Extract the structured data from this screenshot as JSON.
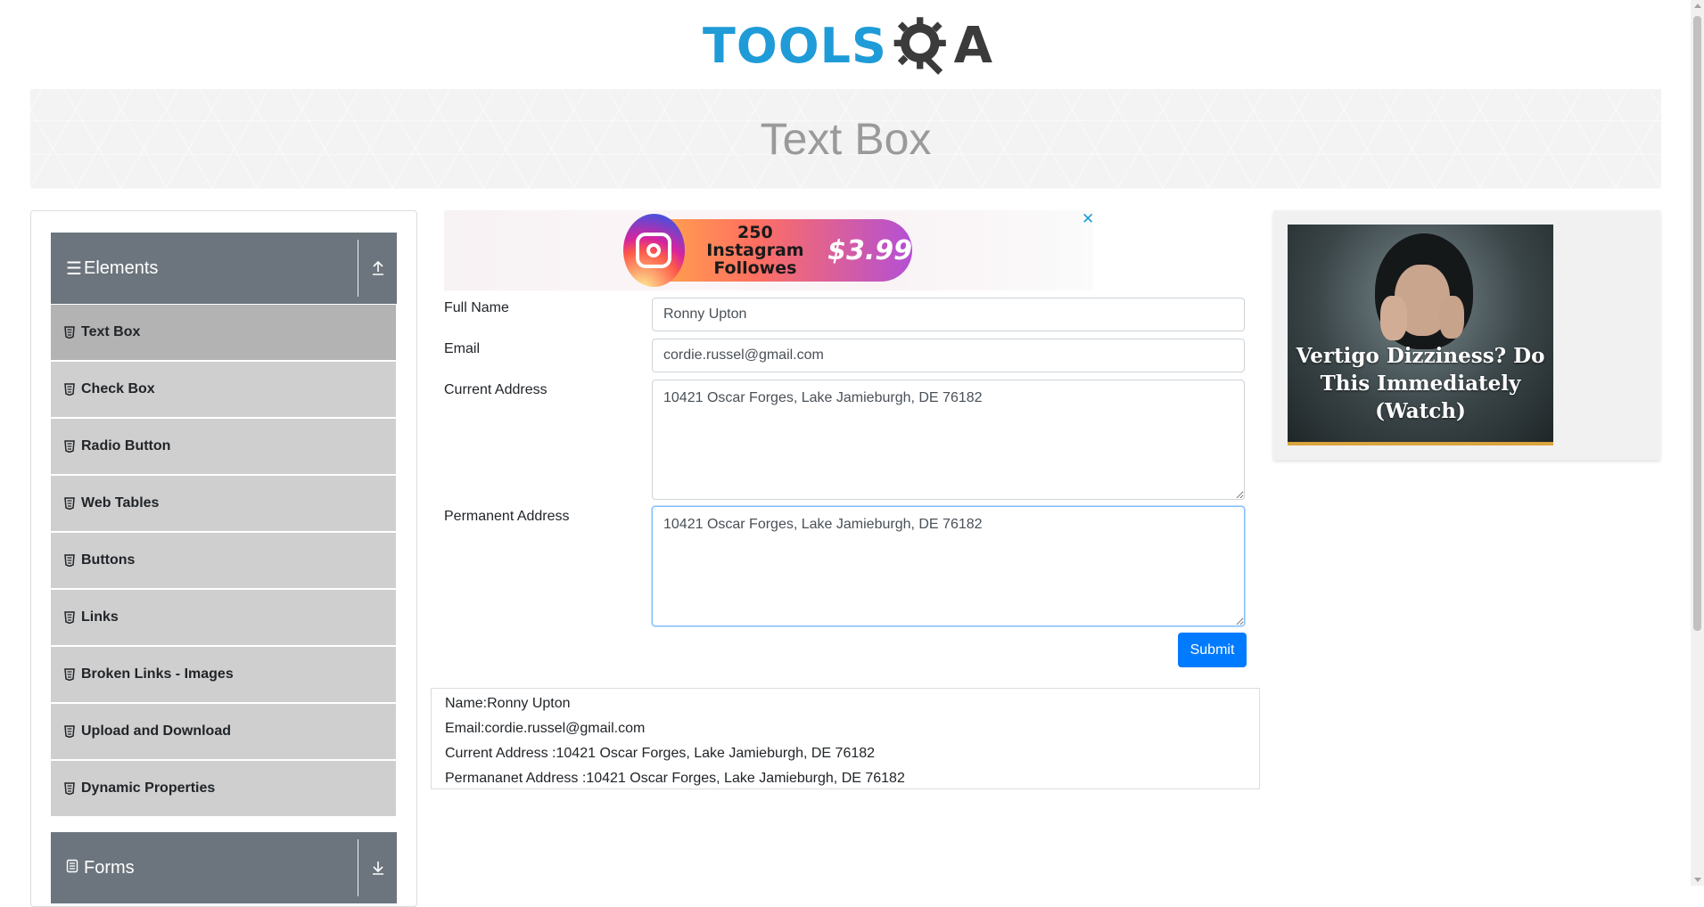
{
  "header": {
    "logo_part1": "TOOLS",
    "logo_part2": "QA",
    "banner_title": "Text Box"
  },
  "sidebar": {
    "groups": [
      {
        "label": "Elements",
        "icon": "hamburger-icon",
        "toggle_icon": "collapse-up-icon"
      },
      {
        "label": "Forms",
        "icon": "document-icon",
        "toggle_icon": "expand-down-icon"
      }
    ],
    "items": [
      {
        "label": "Text Box",
        "active": true
      },
      {
        "label": "Check Box"
      },
      {
        "label": "Radio Button"
      },
      {
        "label": "Web Tables"
      },
      {
        "label": "Buttons"
      },
      {
        "label": "Links"
      },
      {
        "label": "Broken Links - Images"
      },
      {
        "label": "Upload and Download"
      },
      {
        "label": "Dynamic Properties"
      }
    ]
  },
  "ad_top": {
    "line1": "250 Instagram",
    "line2": "Followes",
    "price": "$3.99",
    "close": "✕"
  },
  "form": {
    "full_name_label": "Full Name",
    "full_name_value": "Ronny Upton",
    "email_label": "Email",
    "email_value": "cordie.russel@gmail.com",
    "current_address_label": "Current Address",
    "current_address_value": "10421 Oscar Forges, Lake Jamieburgh, DE 76182",
    "permanent_address_label": "Permanent Address",
    "permanent_address_value": "10421 Oscar Forges, Lake Jamieburgh, DE 76182",
    "submit_label": "Submit"
  },
  "output": {
    "name": "Name:Ronny Upton",
    "email": "Email:cordie.russel@gmail.com",
    "current_address": "Current Address :10421 Oscar Forges, Lake Jamieburgh, DE 76182",
    "permanent_address": "Permananet Address :10421 Oscar Forges, Lake Jamieburgh, DE 76182"
  },
  "ad_right": {
    "headline": "Vertigo Dizziness? Do This Immediately (Watch)"
  },
  "colors": {
    "brand_blue": "#1f9bd7",
    "primary_button": "#007bff",
    "group_header": "#6c757d",
    "menu_item": "#cfcfcf",
    "menu_item_active": "#b3b3b3"
  }
}
